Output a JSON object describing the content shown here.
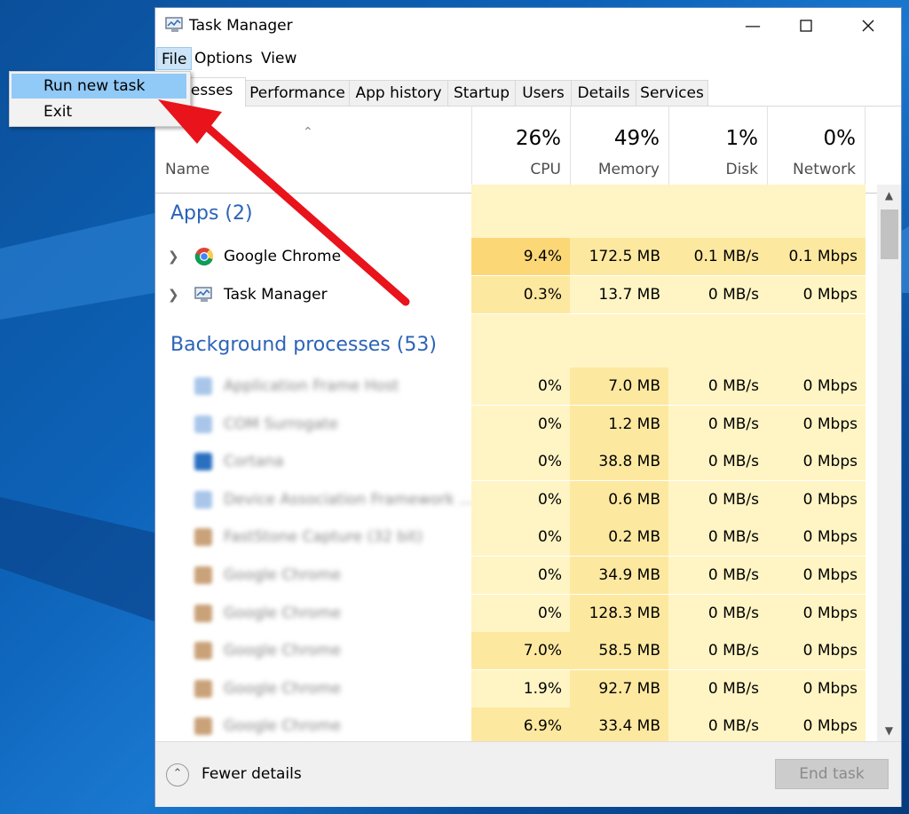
{
  "window": {
    "title": "Task Manager"
  },
  "menubar": {
    "file": "File",
    "options": "Options",
    "view": "View"
  },
  "file_menu": {
    "run_new_task": "Run new task",
    "exit": "Exit"
  },
  "tabs": [
    "cesses",
    "Performance",
    "App history",
    "Startup",
    "Users",
    "Details",
    "Services"
  ],
  "header": {
    "name_label": "Name",
    "cpu": {
      "pct": "26%",
      "label": "CPU"
    },
    "memory": {
      "pct": "49%",
      "label": "Memory"
    },
    "disk": {
      "pct": "1%",
      "label": "Disk"
    },
    "network": {
      "pct": "0%",
      "label": "Network"
    }
  },
  "sections": {
    "apps": "Apps (2)",
    "background": "Background processes (53)"
  },
  "apps": [
    {
      "name": "Google Chrome",
      "cpu": "9.4%",
      "memory": "172.5 MB",
      "disk": "0.1 MB/s",
      "network": "0.1 Mbps"
    },
    {
      "name": "Task Manager",
      "cpu": "0.3%",
      "memory": "13.7 MB",
      "disk": "0 MB/s",
      "network": "0 Mbps"
    }
  ],
  "background": [
    {
      "name": "Application Frame Host",
      "cpu": "0%",
      "memory": "7.0 MB",
      "disk": "0 MB/s",
      "network": "0 Mbps"
    },
    {
      "name": "COM Surrogate",
      "cpu": "0%",
      "memory": "1.2 MB",
      "disk": "0 MB/s",
      "network": "0 Mbps"
    },
    {
      "name": "Cortana",
      "cpu": "0%",
      "memory": "38.8 MB",
      "disk": "0 MB/s",
      "network": "0 Mbps"
    },
    {
      "name": "Device Association Framework ...",
      "cpu": "0%",
      "memory": "0.6 MB",
      "disk": "0 MB/s",
      "network": "0 Mbps"
    },
    {
      "name": "FastStone Capture (32 bit)",
      "cpu": "0%",
      "memory": "0.2 MB",
      "disk": "0 MB/s",
      "network": "0 Mbps"
    },
    {
      "name": "Google Chrome",
      "cpu": "0%",
      "memory": "34.9 MB",
      "disk": "0 MB/s",
      "network": "0 Mbps"
    },
    {
      "name": "Google Chrome",
      "cpu": "0%",
      "memory": "128.3 MB",
      "disk": "0 MB/s",
      "network": "0 Mbps"
    },
    {
      "name": "Google Chrome",
      "cpu": "7.0%",
      "memory": "58.5 MB",
      "disk": "0 MB/s",
      "network": "0 Mbps"
    },
    {
      "name": "Google Chrome",
      "cpu": "1.9%",
      "memory": "92.7 MB",
      "disk": "0 MB/s",
      "network": "0 Mbps"
    },
    {
      "name": "Google Chrome",
      "cpu": "6.9%",
      "memory": "33.4 MB",
      "disk": "0 MB/s",
      "network": "0 Mbps"
    }
  ],
  "footer": {
    "fewer_details": "Fewer details",
    "end_task": "End task"
  },
  "colors": {
    "heat_light": "#fff4c4",
    "heat_mid": "#fde8a0",
    "heat_high": "#fbd776",
    "link_blue": "#2b63b8",
    "annotation_red": "#e8131b"
  },
  "icons": {
    "app_icon": "task-manager-icon",
    "chrome": "chrome-icon"
  }
}
